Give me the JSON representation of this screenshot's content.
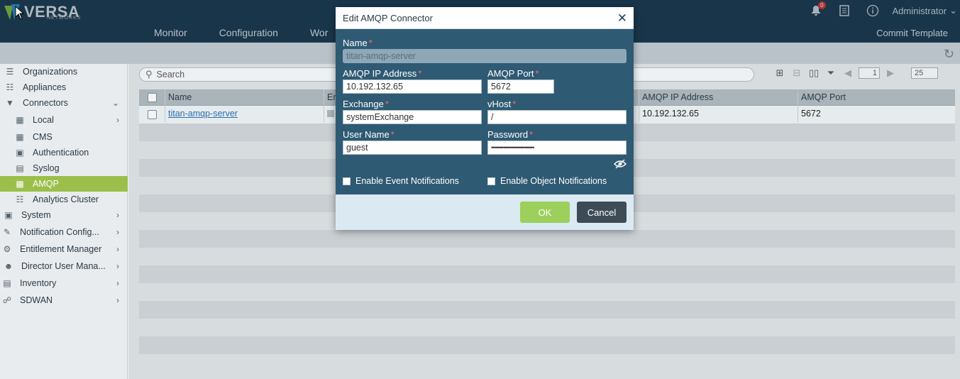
{
  "header": {
    "logo_text": "VERSA",
    "logo_sub": "NETWORKS",
    "nav": [
      "Monitor",
      "Configuration",
      "Wor"
    ],
    "notification_count": "0",
    "user": "Administrator",
    "commit": "Commit Template"
  },
  "sidebar": {
    "items": [
      {
        "label": "Organizations",
        "icon": "org-icon"
      },
      {
        "label": "Appliances",
        "icon": "appliances-icon"
      },
      {
        "label": "Connectors",
        "icon": "connector-icon"
      },
      {
        "label": "Local",
        "icon": "local-icon"
      },
      {
        "label": "CMS",
        "icon": "cms-icon"
      },
      {
        "label": "Authentication",
        "icon": "auth-icon"
      },
      {
        "label": "Syslog",
        "icon": "syslog-icon"
      },
      {
        "label": "AMQP",
        "icon": "amqp-icon"
      },
      {
        "label": "Analytics Cluster",
        "icon": "analytics-icon"
      },
      {
        "label": "System",
        "icon": "system-icon"
      },
      {
        "label": "Notification Config...",
        "icon": "notification-icon"
      },
      {
        "label": "Entitlement Manager",
        "icon": "entitlement-icon"
      },
      {
        "label": "Director User Mana...",
        "icon": "users-icon"
      },
      {
        "label": "Inventory",
        "icon": "inventory-icon"
      },
      {
        "label": "SDWAN",
        "icon": "sdwan-icon"
      }
    ]
  },
  "toolbar": {
    "search_placeholder": "Search",
    "page": "1",
    "page_size": "25"
  },
  "grid": {
    "columns": [
      "Name",
      "En",
      "AMQP IP Address",
      "AMQP Port"
    ],
    "rows": [
      {
        "name": "titan-amqp-server",
        "ip": "10.192.132.65",
        "port": "5672"
      }
    ]
  },
  "modal": {
    "title": "Edit AMQP Connector",
    "name_label": "Name",
    "name_value": "titan-amqp-server",
    "ip_label": "AMQP IP Address",
    "ip_value": "10.192.132.65",
    "port_label": "AMQP Port",
    "port_value": "5672",
    "exchange_label": "Exchange",
    "exchange_value": "systemExchange",
    "vhost_label": "vHost",
    "vhost_value": "/",
    "user_label": "User Name",
    "user_value": "guest",
    "password_label": "Password",
    "password_value": "••••••••••••••••••••••••••••",
    "event_notifications": "Enable Event Notifications",
    "object_notifications": "Enable Object Notifications",
    "ok": "OK",
    "cancel": "Cancel"
  }
}
